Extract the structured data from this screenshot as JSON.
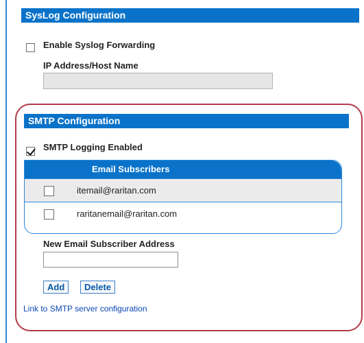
{
  "syslog": {
    "header": "SysLog Configuration",
    "enable_label": "Enable Syslog Forwarding",
    "enable_checked": false,
    "ip_label": "IP Address/Host Name",
    "ip_value": ""
  },
  "smtp": {
    "header": "SMTP Configuration",
    "logging_label": "SMTP Logging Enabled",
    "logging_checked": true,
    "subscribers_header": "Email Subscribers",
    "subscribers": [
      {
        "email": "itemail@raritan.com",
        "checked": false
      },
      {
        "email": "raritanemail@raritan.com",
        "checked": false
      }
    ],
    "new_address_label": "New Email Subscriber Address",
    "new_address_value": "",
    "add_label": "Add",
    "delete_label": "Delete",
    "server_link": "Link to SMTP server configuration"
  },
  "colors": {
    "header_blue": "#0a73c9",
    "frame_red": "#b23a48",
    "link_blue": "#0b46b4"
  }
}
